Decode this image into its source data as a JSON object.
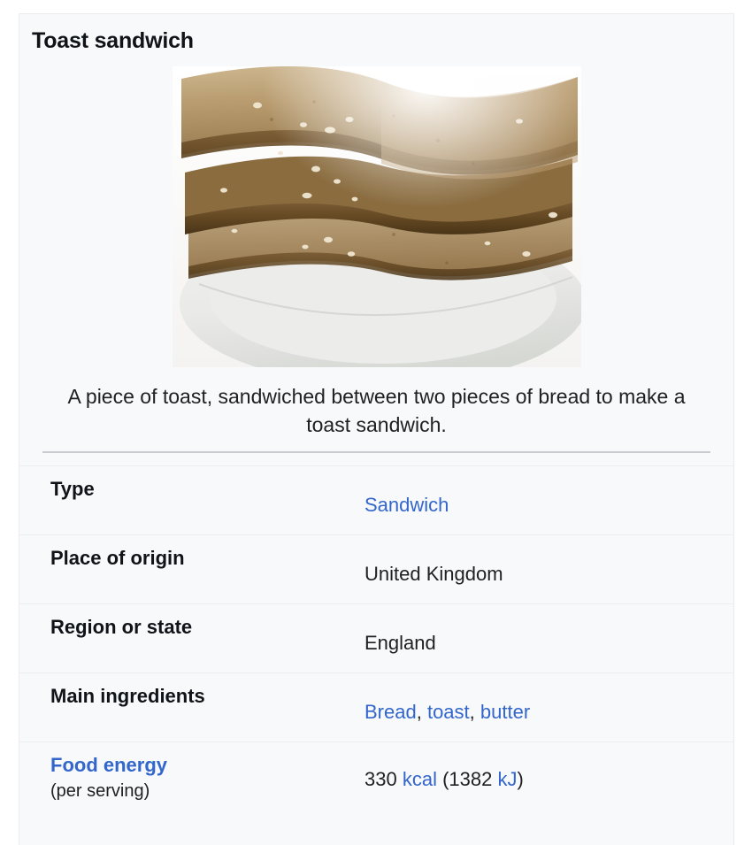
{
  "infobox": {
    "title": "Toast sandwich",
    "image": {
      "alt": "toast-sandwich-photo",
      "caption": "A piece of toast, sandwiched between two pieces of bread to make a toast sandwich."
    },
    "rows": [
      {
        "label": "Type",
        "sublabel": "",
        "label_is_link": false,
        "value_parts": [
          {
            "text": "Sandwich",
            "link": true
          }
        ]
      },
      {
        "label": "Place of origin",
        "sublabel": "",
        "label_is_link": false,
        "value_parts": [
          {
            "text": "United Kingdom",
            "link": false
          }
        ]
      },
      {
        "label": "Region or state",
        "sublabel": "",
        "label_is_link": false,
        "value_parts": [
          {
            "text": "England",
            "link": false
          }
        ]
      },
      {
        "label": "Main ingredients",
        "sublabel": "",
        "label_is_link": false,
        "value_parts": [
          {
            "text": "Bread",
            "link": true
          },
          {
            "text": ", ",
            "link": false
          },
          {
            "text": "toast",
            "link": true
          },
          {
            "text": ", ",
            "link": false
          },
          {
            "text": "butter",
            "link": true
          }
        ]
      },
      {
        "label": "Food energy",
        "sublabel": "(per serving)",
        "label_is_link": true,
        "value_parts": [
          {
            "text": "330 ",
            "link": false
          },
          {
            "text": "kcal",
            "link": true
          },
          {
            "text": " (1382 ",
            "link": false
          },
          {
            "text": "kJ",
            "link": true
          },
          {
            "text": ")",
            "link": false
          }
        ]
      }
    ]
  },
  "colors": {
    "link": "#3366cc",
    "text": "#202122",
    "heading": "#101418",
    "card_bg": "#f8f9fa",
    "card_border": "#eaecf0",
    "row_border": "#eceff2",
    "separator": "#c8ccd1"
  }
}
